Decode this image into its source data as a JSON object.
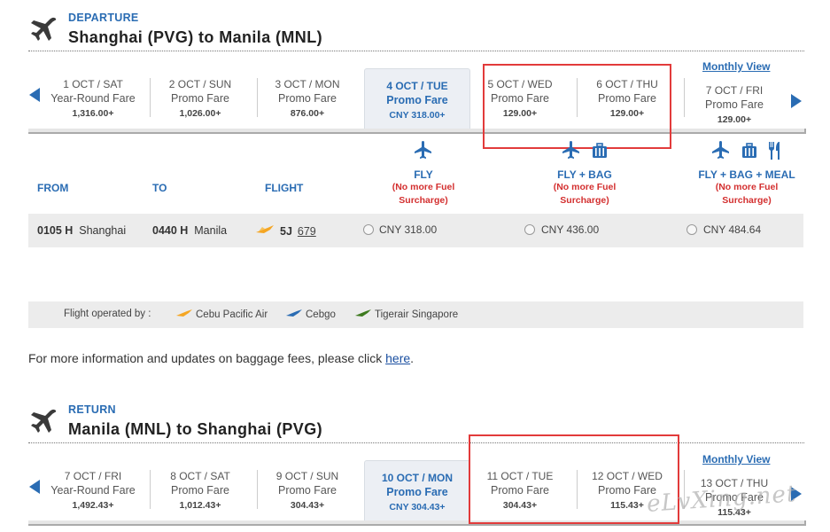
{
  "departure": {
    "label": "DEPARTURE",
    "route": "Shanghai (PVG) to Manila (MNL)",
    "monthly_view": "Monthly View",
    "dates": [
      {
        "date": "1 OCT / SAT",
        "fare": "Year-Round Fare",
        "price": "1,316.00+"
      },
      {
        "date": "2 OCT / SUN",
        "fare": "Promo Fare",
        "price": "1,026.00+"
      },
      {
        "date": "3 OCT / MON",
        "fare": "Promo Fare",
        "price": "876.00+"
      },
      {
        "date": "4 OCT / TUE",
        "fare": "Promo Fare",
        "price": "CNY 318.00+"
      },
      {
        "date": "5 OCT / WED",
        "fare": "Promo Fare",
        "price": "129.00+"
      },
      {
        "date": "6 OCT / THU",
        "fare": "Promo Fare",
        "price": "129.00+"
      },
      {
        "date": "7 OCT / FRI",
        "fare": "Promo Fare",
        "price": "129.00+"
      }
    ],
    "fare_types": [
      {
        "name": "FLY",
        "note1": "(No more Fuel",
        "note2": "Surcharge)"
      },
      {
        "name": "FLY + BAG",
        "note1": "(No more Fuel",
        "note2": "Surcharge)"
      },
      {
        "name": "FLY + BAG + MEAL",
        "note1": "(No more Fuel",
        "note2": "Surcharge)"
      }
    ],
    "columns": {
      "from": "FROM",
      "to": "TO",
      "flight": "FLIGHT"
    },
    "flight": {
      "dep_time": "0105 H",
      "dep_city": "Shanghai",
      "arr_time": "0440 H",
      "arr_city": "Manila",
      "carrier": "5J",
      "number": "679",
      "fares": [
        "CNY 318.00",
        "CNY 436.00",
        "CNY 484.64"
      ]
    }
  },
  "operated_by": {
    "label": "Flight operated by :",
    "airlines": [
      "Cebu Pacific Air",
      "Cebgo",
      "Tigerair Singapore"
    ]
  },
  "info": {
    "text": "For more information and updates on baggage fees, please click ",
    "link": "here",
    "end": "."
  },
  "return": {
    "label": "RETURN",
    "route": "Manila (MNL) to Shanghai (PVG)",
    "monthly_view": "Monthly View",
    "dates": [
      {
        "date": "7 OCT / FRI",
        "fare": "Year-Round Fare",
        "price": "1,492.43+"
      },
      {
        "date": "8 OCT / SAT",
        "fare": "Promo Fare",
        "price": "1,012.43+"
      },
      {
        "date": "9 OCT / SUN",
        "fare": "Promo Fare",
        "price": "304.43+"
      },
      {
        "date": "10 OCT / MON",
        "fare": "Promo Fare",
        "price": "CNY 304.43+"
      },
      {
        "date": "11 OCT / TUE",
        "fare": "Promo Fare",
        "price": "304.43+"
      },
      {
        "date": "12 OCT / WED",
        "fare": "Promo Fare",
        "price": "115.43+"
      },
      {
        "date": "13 OCT / THU",
        "fare": "Promo Fare",
        "price": "115.43+"
      }
    ]
  },
  "watermark": "eLvXing.net",
  "colors": {
    "accent": "#2a6cb3",
    "highlight": "#e23b3b",
    "surcharge": "#d32f2f"
  },
  "icons": [
    "airplane-icon",
    "airplane-tail-icon",
    "luggage-icon",
    "meal-icon",
    "chevron-left-icon",
    "chevron-right-icon"
  ]
}
